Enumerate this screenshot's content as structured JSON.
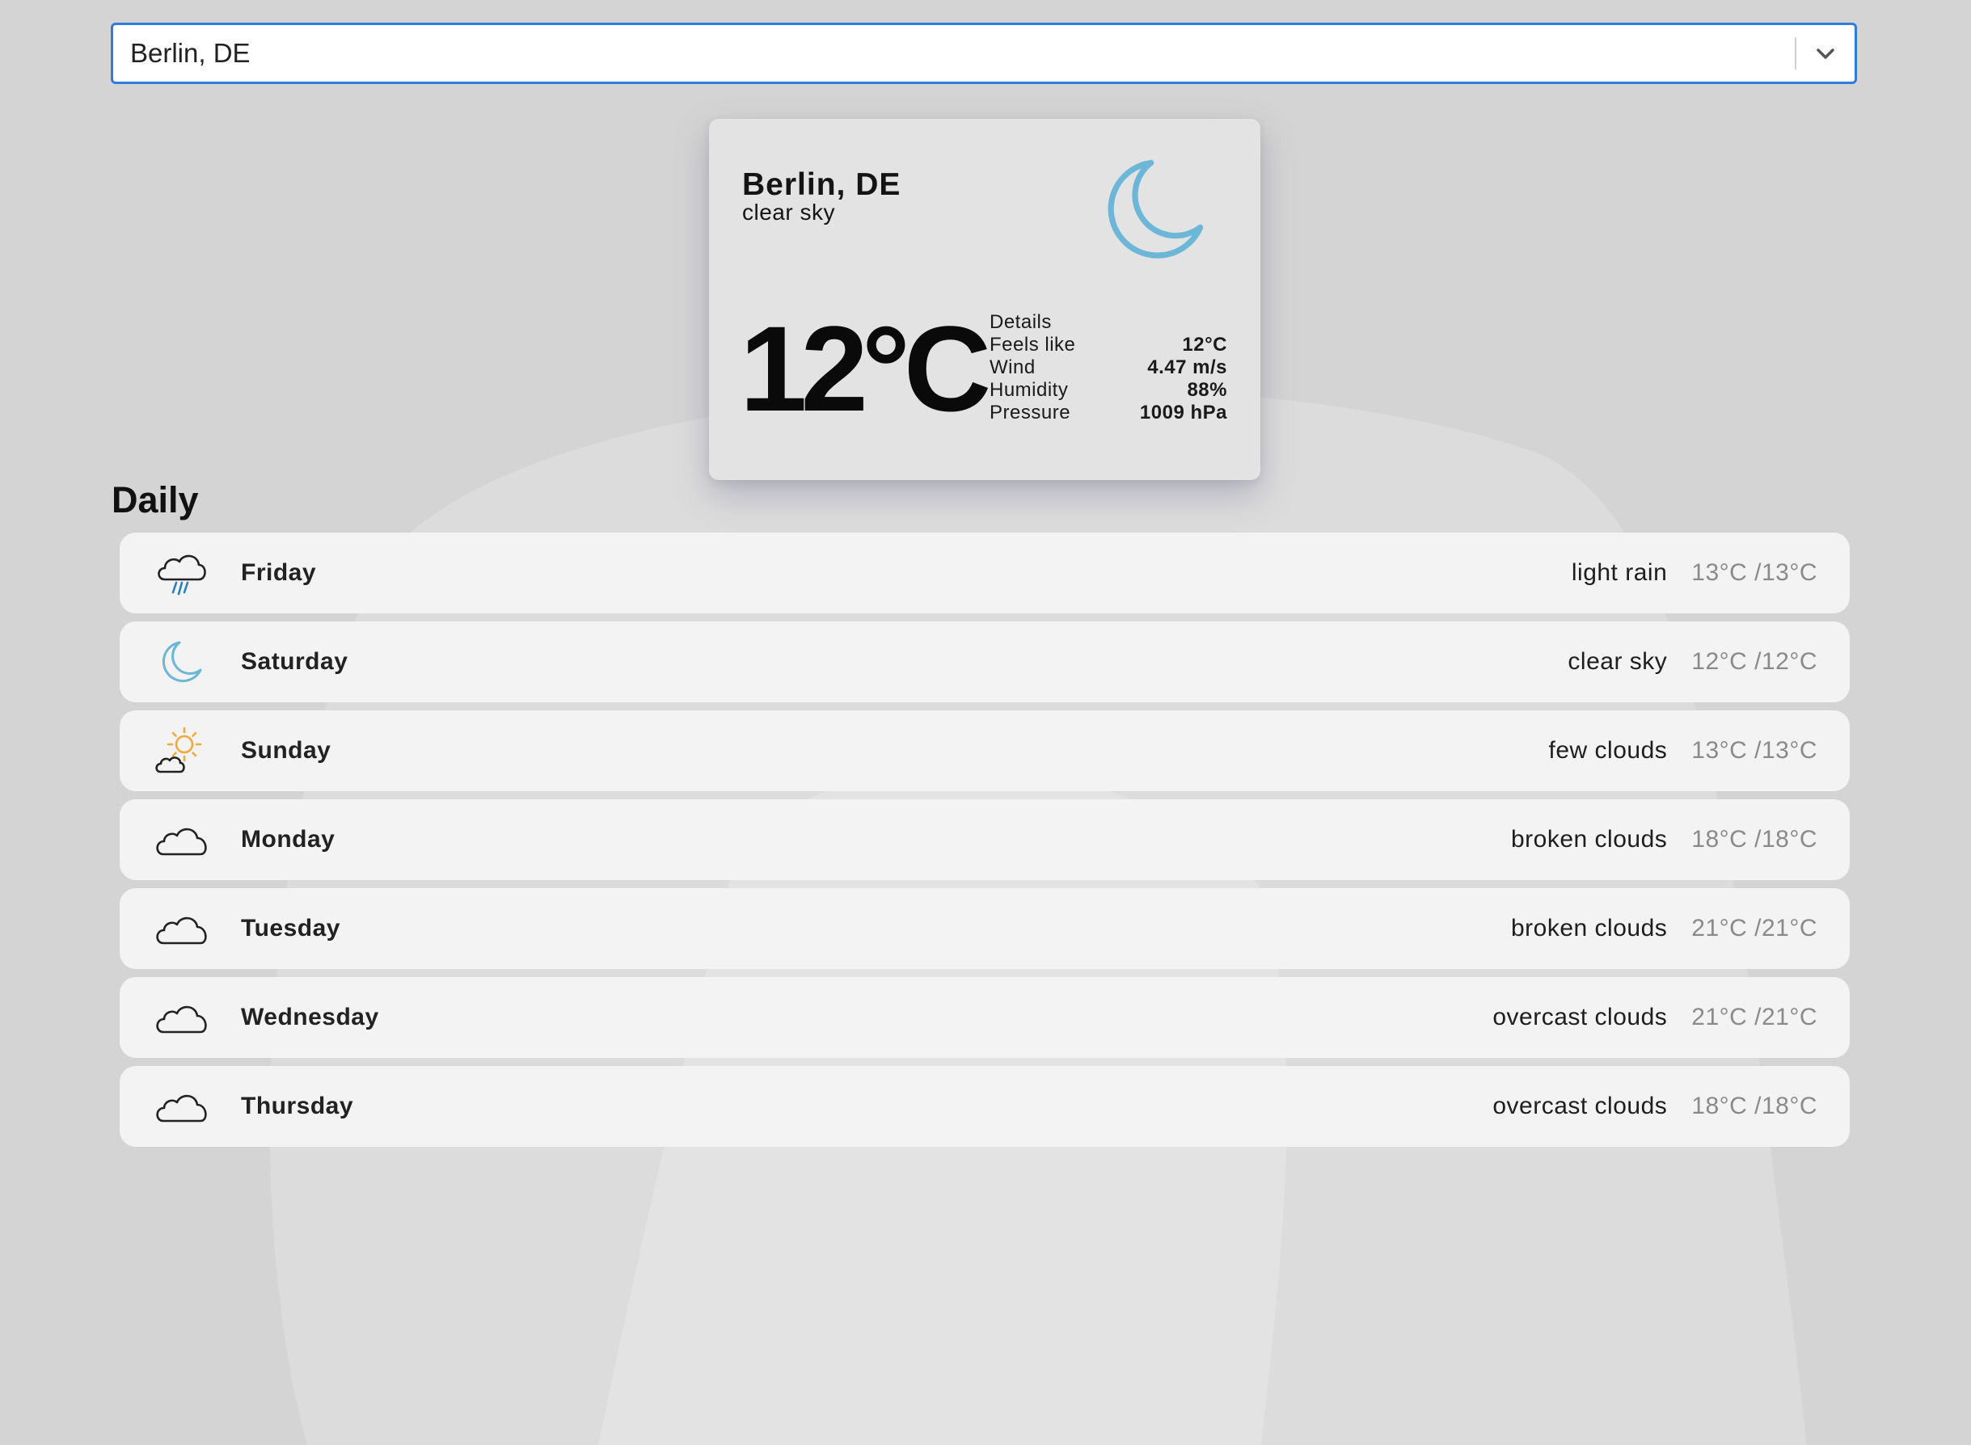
{
  "search": {
    "selected_value": "Berlin, DE",
    "dropdown_icon": "chevron-down-icon"
  },
  "current": {
    "city": "Berlin, DE",
    "description": "clear sky",
    "icon": "moon-icon",
    "temperature": "12°C",
    "details_title": "Details",
    "details": [
      {
        "label": "Feels like",
        "value": "12°C"
      },
      {
        "label": "Wind",
        "value": "4.47 m/s"
      },
      {
        "label": "Humidity",
        "value": "88%"
      },
      {
        "label": "Pressure",
        "value": "1009 hPa"
      }
    ]
  },
  "daily": {
    "title": "Daily",
    "days": [
      {
        "name": "Friday",
        "description": "light rain",
        "temp": "13°C /13°C",
        "icon": "rain-cloud-icon"
      },
      {
        "name": "Saturday",
        "description": "clear sky",
        "temp": "12°C /12°C",
        "icon": "moon-icon"
      },
      {
        "name": "Sunday",
        "description": "few clouds",
        "temp": "13°C /13°C",
        "icon": "sun-cloud-icon"
      },
      {
        "name": "Monday",
        "description": "broken clouds",
        "temp": "18°C /18°C",
        "icon": "cloud-icon"
      },
      {
        "name": "Tuesday",
        "description": "broken clouds",
        "temp": "21°C /21°C",
        "icon": "cloud-icon"
      },
      {
        "name": "Wednesday",
        "description": "overcast clouds",
        "temp": "21°C /21°C",
        "icon": "cloud-icon"
      },
      {
        "name": "Thursday",
        "description": "overcast clouds",
        "temp": "18°C /18°C",
        "icon": "cloud-icon"
      }
    ]
  },
  "colors": {
    "background": "#d4d4d4",
    "accent_border": "#2f7be0",
    "moon": "#6cb6d8",
    "sun": "#f2a93b",
    "rain": "#2a7fc0"
  }
}
